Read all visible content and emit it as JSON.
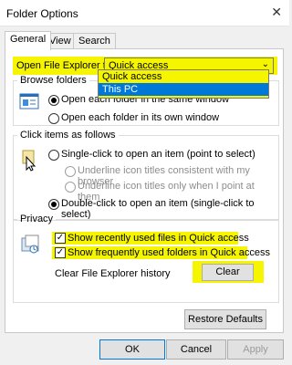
{
  "window": {
    "title": "Folder Options",
    "close_glyph": "✕"
  },
  "tabs": [
    {
      "label": "General"
    },
    {
      "label": "View"
    },
    {
      "label": "Search"
    }
  ],
  "open_explorer": {
    "label": "Open File Explorer to:",
    "selected": "Quick access",
    "options": [
      "Quick access",
      "This PC"
    ]
  },
  "browse": {
    "title": "Browse folders",
    "option1": "Open each folder in the same window",
    "option2": "Open each folder in its own window"
  },
  "click_items": {
    "title": "Click items as follows",
    "single": "Single-click to open an item (point to select)",
    "underline_browser": "Underline icon titles consistent with my browser",
    "underline_point": "Underline icon titles only when I point at them",
    "double": "Double-click to open an item (single-click to select)"
  },
  "privacy": {
    "title": "Privacy",
    "recent_files": "Show recently used files in Quick access",
    "frequent_folders": "Show frequently used folders in Quick access",
    "clear_label": "Clear File Explorer history",
    "clear_button": "Clear"
  },
  "restore_defaults": "Restore Defaults",
  "buttons": {
    "ok": "OK",
    "cancel": "Cancel",
    "apply": "Apply"
  },
  "colors": {
    "highlight": "#f6f500",
    "selection": "#0078d7"
  }
}
